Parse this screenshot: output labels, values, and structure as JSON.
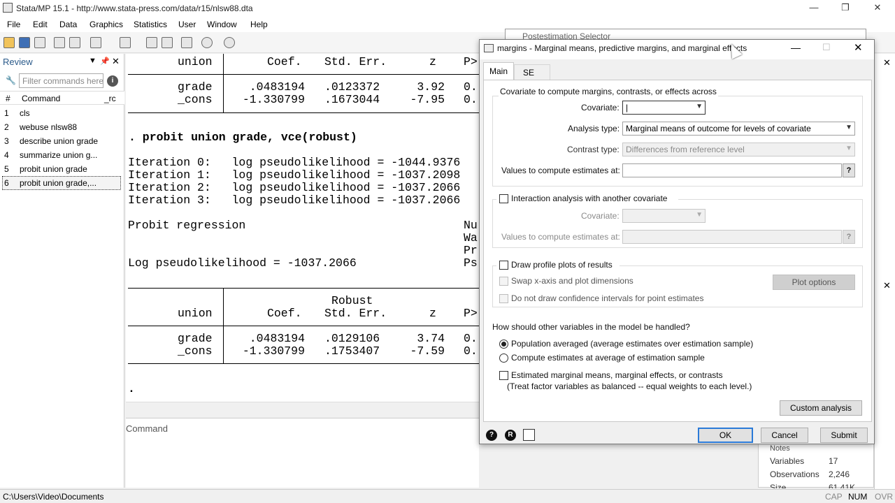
{
  "window": {
    "title": "Stata/MP 15.1 - http://www.stata-press.com/data/r15/nlsw88.dta",
    "min": "—",
    "max": "❐",
    "close": "✕"
  },
  "menu": [
    "File",
    "Edit",
    "Data",
    "Graphics",
    "Statistics",
    "User",
    "Window",
    "Help"
  ],
  "review": {
    "title": "Review",
    "filter_placeholder": "Filter commands here",
    "col_num": "#",
    "col_command": "Command",
    "col_rc": "_rc",
    "items": [
      {
        "n": "1",
        "cmd": "cls"
      },
      {
        "n": "2",
        "cmd": "webuse nlsw88"
      },
      {
        "n": "3",
        "cmd": "describe union grade"
      },
      {
        "n": "4",
        "cmd": "summarize union g..."
      },
      {
        "n": "5",
        "cmd": "probit union grade"
      },
      {
        "n": "6",
        "cmd": "probit union grade,..."
      }
    ]
  },
  "results": {
    "t1_header": [
      "union",
      "Coef.",
      "Std. Err.",
      "z",
      "P>"
    ],
    "t1_rows": [
      {
        "var": "grade",
        "coef": ".0483194",
        "se": ".0123372",
        "z": "3.92",
        "p": "0."
      },
      {
        "var": "_cons",
        "coef": "-1.330799",
        "se": ".1673044",
        "z": "-7.95",
        "p": "0."
      }
    ],
    "command": ". probit union grade, vce(robust)",
    "iterations": [
      "Iteration 0:   log pseudolikelihood = -1044.9376",
      "Iteration 1:   log pseudolikelihood = -1037.2098",
      "Iteration 2:   log pseudolikelihood = -1037.2066",
      "Iteration 3:   log pseudolikelihood = -1037.2066"
    ],
    "model": "Probit regression",
    "right_labels": [
      "Nu",
      "Wa",
      "Pr",
      "Ps"
    ],
    "loglik": "Log pseudolikelihood = -1037.2066",
    "t2_robust": "Robust",
    "t2_header": [
      "union",
      "Coef.",
      "Std. Err.",
      "z",
      "P>"
    ],
    "t2_rows": [
      {
        "var": "grade",
        "coef": ".0483194",
        "se": ".0129106",
        "z": "3.74",
        "p": "0."
      },
      {
        "var": "_cons",
        "coef": "-1.330799",
        "se": ".1753407",
        "z": "-7.59",
        "p": "0."
      }
    ],
    "prompt": "."
  },
  "command_label": "Command",
  "status": {
    "path": "C:\\Users\\Video\\Documents",
    "cap": "CAP",
    "num": "NUM",
    "ovr": "OVR"
  },
  "bg_dialog_title": "Postestimation Selector",
  "properties": {
    "section": "Notes",
    "rows": [
      {
        "k": "Variables",
        "v": "17"
      },
      {
        "k": "Observations",
        "v": "2,246"
      },
      {
        "k": "Size",
        "v": "61.41K"
      }
    ]
  },
  "dialog": {
    "title": "margins - Marginal means, predictive margins, and marginal effects",
    "tabs": [
      "Main",
      "SE"
    ],
    "group1_title": "Covariate to compute margins, contrasts, or effects across",
    "covariate_label": "Covariate:",
    "covariate_value": "|",
    "analysis_type_label": "Analysis type:",
    "analysis_type_value": "Marginal means of outcome for levels of covariate",
    "contrast_type_label": "Contrast type:",
    "contrast_type_value": "Differences from reference level",
    "values_label": "Values to compute estimates at:",
    "help_q": "?",
    "interaction_label": "Interaction analysis with another covariate",
    "int_covariate_label": "Covariate:",
    "int_values_label": "Values to compute estimates at:",
    "profile_label": "Draw profile plots of results",
    "swap_label": "Swap x-axis and plot dimensions",
    "noci_label": "Do not draw confidence intervals for point estimates",
    "plot_options": "Plot options",
    "other_vars_q": "How should other variables in the model be handled?",
    "radio_pop": "Population averaged (average estimates over estimation sample)",
    "radio_avg": "Compute estimates at average of estimation sample",
    "balanced_label": "Estimated marginal means, marginal effects, or contrasts",
    "balanced_note": "(Treat factor variables as balanced -- equal weights to each level.)",
    "custom_analysis": "Custom analysis",
    "icon_help": "?",
    "icon_r": "R",
    "ok": "OK",
    "cancel": "Cancel",
    "submit": "Submit"
  }
}
